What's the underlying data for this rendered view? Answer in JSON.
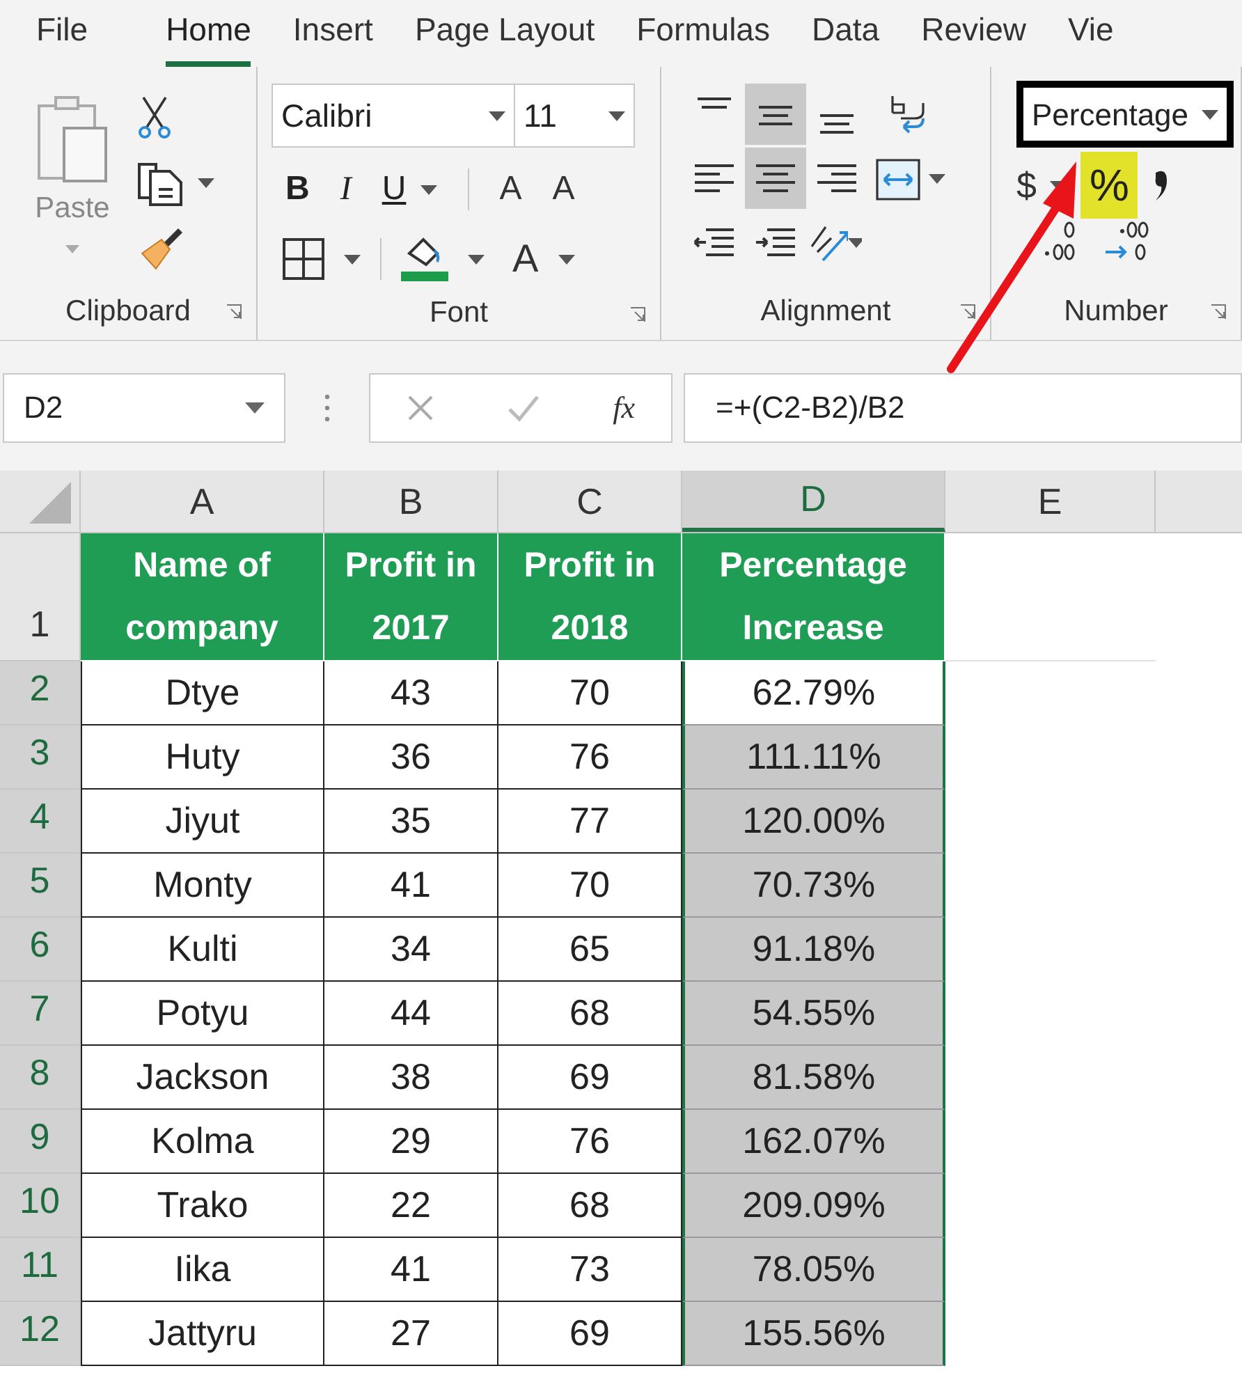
{
  "tabs": [
    {
      "label": "File",
      "selected": false
    },
    {
      "label": "Home",
      "selected": true
    },
    {
      "label": "Insert",
      "selected": false
    },
    {
      "label": "Page Layout",
      "selected": false
    },
    {
      "label": "Formulas",
      "selected": false
    },
    {
      "label": "Data",
      "selected": false
    },
    {
      "label": "Review",
      "selected": false
    },
    {
      "label": "Vie",
      "selected": false
    }
  ],
  "ribbon": {
    "clipboard": {
      "label": "Clipboard",
      "paste": "Paste"
    },
    "font": {
      "label": "Font",
      "font_name": "Calibri",
      "font_size": "11",
      "bold": "B",
      "italic": "I",
      "underline": "U",
      "grow": "A",
      "shrink": "A",
      "font_color": "A"
    },
    "alignment": {
      "label": "Alignment",
      "buttons": [
        {
          "kind": "top",
          "selected": false
        },
        {
          "kind": "middle",
          "selected": true
        },
        {
          "kind": "bottom",
          "selected": false
        },
        {
          "kind": "wrap",
          "selected": false
        },
        {
          "kind": "left",
          "selected": false
        },
        {
          "kind": "center",
          "selected": true
        },
        {
          "kind": "right",
          "selected": false
        },
        {
          "kind": "merge",
          "selected": false
        },
        {
          "kind": "outdent",
          "selected": false
        },
        {
          "kind": "indent",
          "selected": false
        },
        {
          "kind": "orientation",
          "selected": false
        }
      ]
    },
    "number": {
      "label": "Number",
      "format": "Percentage",
      "format_outlined": true,
      "currency": "$",
      "percent": "%",
      "percent_highlighted": true
    }
  },
  "formula_bar": {
    "name_box": "D2",
    "function_label": "fx",
    "formula": "=+(C2-B2)/B2"
  },
  "columns": [
    {
      "label": "A",
      "selected": false
    },
    {
      "label": "B",
      "selected": false
    },
    {
      "label": "C",
      "selected": false
    },
    {
      "label": "D",
      "selected": true
    },
    {
      "label": "E",
      "selected": false
    }
  ],
  "header_row": {
    "number": "1",
    "selected": false,
    "cells": [
      "Name of company",
      "Profit in 2017",
      "Profit in 2018",
      "Percentage Increase"
    ]
  },
  "rows": [
    {
      "number": "2",
      "selected": true,
      "range_fill": false,
      "cells": [
        "Dtye",
        "43",
        "70",
        "62.79%"
      ]
    },
    {
      "number": "3",
      "selected": true,
      "range_fill": true,
      "cells": [
        "Huty",
        "36",
        "76",
        "111.11%"
      ]
    },
    {
      "number": "4",
      "selected": true,
      "range_fill": true,
      "cells": [
        "Jiyut",
        "35",
        "77",
        "120.00%"
      ]
    },
    {
      "number": "5",
      "selected": true,
      "range_fill": true,
      "cells": [
        "Monty",
        "41",
        "70",
        "70.73%"
      ]
    },
    {
      "number": "6",
      "selected": true,
      "range_fill": true,
      "cells": [
        "Kulti",
        "34",
        "65",
        "91.18%"
      ]
    },
    {
      "number": "7",
      "selected": true,
      "range_fill": true,
      "cells": [
        "Potyu",
        "44",
        "68",
        "54.55%"
      ]
    },
    {
      "number": "8",
      "selected": true,
      "range_fill": true,
      "cells": [
        "Jackson",
        "38",
        "69",
        "81.58%"
      ]
    },
    {
      "number": "9",
      "selected": true,
      "range_fill": true,
      "cells": [
        "Kolma",
        "29",
        "76",
        "162.07%"
      ]
    },
    {
      "number": "10",
      "selected": true,
      "range_fill": true,
      "cells": [
        "Trako",
        "22",
        "68",
        "209.09%"
      ]
    },
    {
      "number": "11",
      "selected": true,
      "range_fill": true,
      "cells": [
        "Iika",
        "41",
        "73",
        "78.05%"
      ]
    },
    {
      "number": "12",
      "selected": true,
      "range_fill": true,
      "cells": [
        "Jattyru",
        "27",
        "69",
        "155.56%"
      ]
    }
  ]
}
